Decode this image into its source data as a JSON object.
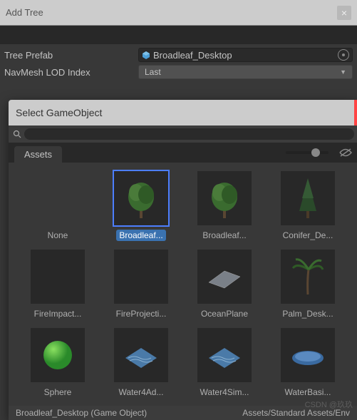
{
  "window": {
    "title": "Add Tree",
    "close_label": "×"
  },
  "props": {
    "prefab_label": "Tree Prefab",
    "prefab_value": "Broadleaf_Desktop",
    "lod_label": "NavMesh LOD Index",
    "lod_value": "Last"
  },
  "popup": {
    "title": "Select GameObject",
    "search_placeholder": "",
    "tab_label": "Assets",
    "items": [
      {
        "label": "None",
        "kind": "none"
      },
      {
        "label": "Broadleaf...",
        "kind": "tree-green",
        "selected": true
      },
      {
        "label": "Broadleaf...",
        "kind": "tree-green"
      },
      {
        "label": "Conifer_De...",
        "kind": "tree-dark"
      },
      {
        "label": "FireImpact...",
        "kind": "empty"
      },
      {
        "label": "FireProjecti...",
        "kind": "empty"
      },
      {
        "label": "OceanPlane",
        "kind": "plane"
      },
      {
        "label": "Palm_Desk...",
        "kind": "palm"
      },
      {
        "label": "Sphere",
        "kind": "sphere"
      },
      {
        "label": "Water4Ad...",
        "kind": "water-square"
      },
      {
        "label": "Water4Sim...",
        "kind": "water-square"
      },
      {
        "label": "WaterBasi...",
        "kind": "water-round"
      }
    ],
    "status_left": "Broadleaf_Desktop (Game Object)",
    "status_right": "Assets/Standard Assets/Env"
  },
  "watermark": "CSDN @玖玖"
}
